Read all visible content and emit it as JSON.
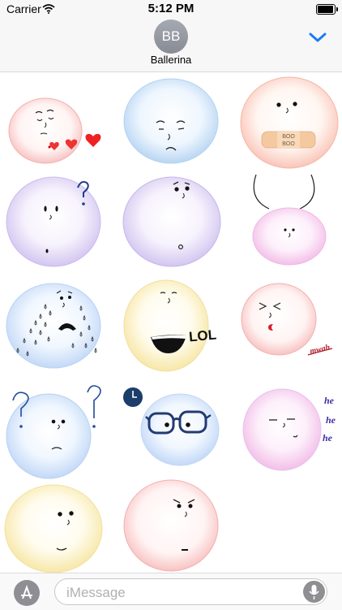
{
  "status_bar": {
    "carrier": "Carrier",
    "time": "5:12 PM",
    "wifi_icon": "wifi-icon",
    "battery_icon": "battery-icon"
  },
  "header": {
    "avatar_initials": "BB",
    "contact_name": "Ballerina",
    "chevron_icon": "chevron-down-icon"
  },
  "stickers": {
    "hearts": "hearts-sticker",
    "lol_text": "LOL",
    "bandage_text_1": "BOO",
    "bandage_text_2": "BOO",
    "mwah_text": "mwah",
    "he_1": "he",
    "he_2": "he",
    "he_3": "he"
  },
  "bottom_bar": {
    "app_store_icon": "app-store-icon",
    "input_placeholder": "iMessage",
    "mic_icon": "microphone-icon"
  },
  "colors": {
    "accent": "#1a7cf5",
    "pink": "#f6a8ad",
    "blue": "#a9c9f0",
    "yellow": "#f5e7a4",
    "purple": "#d6c7f1"
  }
}
